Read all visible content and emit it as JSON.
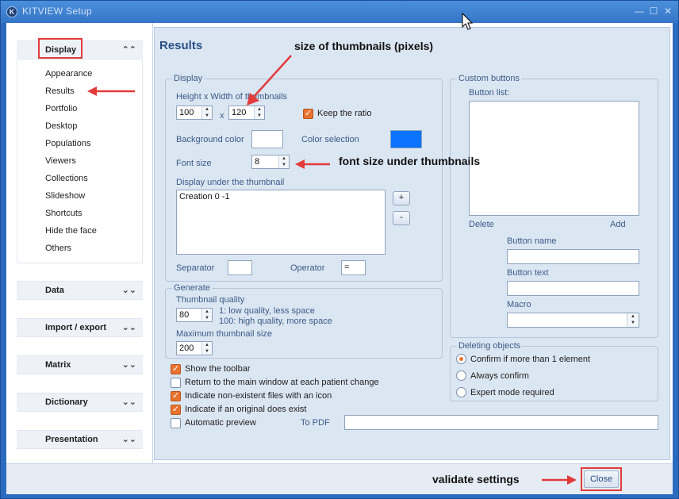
{
  "window": {
    "title": "KITVIEW Setup",
    "icon_letter": "K",
    "controls": [
      "—",
      "☐",
      "✕"
    ]
  },
  "sidebar": {
    "sections": [
      {
        "label": "Display",
        "chevron": "⌃⌃",
        "expanded": true,
        "items": [
          "Appearance",
          "Results",
          "Portfolio",
          "Desktop",
          "Populations",
          "Viewers",
          "Collections",
          "Slideshow",
          "Shortcuts",
          "Hide the face",
          "Others"
        ]
      },
      {
        "label": "Data",
        "chevron": "⌄⌄"
      },
      {
        "label": "Import / export",
        "chevron": "⌄⌄"
      },
      {
        "label": "Matrix",
        "chevron": "⌄⌄"
      },
      {
        "label": "Dictionary",
        "chevron": "⌄⌄"
      },
      {
        "label": "Presentation",
        "chevron": "⌄⌄"
      }
    ]
  },
  "main": {
    "title": "Results",
    "display_group": {
      "legend": "Display",
      "size_label": "Height x Width of thumbnails",
      "height_value": "100",
      "x_label": "x",
      "width_value": "120",
      "keep_ratio_label": "Keep the ratio",
      "keep_ratio_checked": true,
      "background_color_label": "Background color",
      "background_color": "#ffffff",
      "color_selection_label": "Color selection",
      "selection_color": "#0a73ff",
      "font_size_label": "Font size",
      "font_size_value": "8",
      "display_under_label": "Display under the thumbnail",
      "display_under_value": "Creation 0 -1",
      "plus_label": "+",
      "minus_label": "-",
      "separator_label": "Separator",
      "separator_value": "",
      "operator_label": "Operator",
      "operator_value": "="
    },
    "generate_group": {
      "legend": "Generate",
      "quality_label": "Thumbnail quality",
      "quality_value": "80",
      "quality_hint_1": "1: low quality, less space",
      "quality_hint_2": "100: high quality, more space",
      "max_size_label": "Maximum thumbnail size",
      "max_size_value": "200"
    },
    "options": [
      {
        "label": "Show the toolbar",
        "checked": true
      },
      {
        "label": "Return to the main window at each patient change",
        "checked": false
      },
      {
        "label": "Indicate non-existent files with an icon",
        "checked": true
      },
      {
        "label": "Indicate if an original does exist",
        "checked": true
      },
      {
        "label": "Automatic preview",
        "checked": false
      }
    ],
    "to_pdf_label": "To PDF",
    "to_pdf_value": "",
    "custom_buttons": {
      "legend": "Custom buttons",
      "list_label": "Button list:",
      "delete_label": "Delete",
      "add_label": "Add",
      "name_label": "Button name",
      "text_label": "Button text",
      "macro_label": "Macro"
    },
    "deleting": {
      "legend": "Deleting objects",
      "options": [
        {
          "label": "Confirm if more than 1 element",
          "selected": true
        },
        {
          "label": "Always confirm",
          "selected": false
        },
        {
          "label": "Expert mode required",
          "selected": false
        }
      ]
    }
  },
  "footer": {
    "close_label": "Close"
  },
  "annotations": {
    "thumbnail_size": "size of thumbnails (pixels)",
    "font_size": "font size under thumbnails",
    "validate": "validate settings",
    "highlight_color": "#e23b3b"
  }
}
